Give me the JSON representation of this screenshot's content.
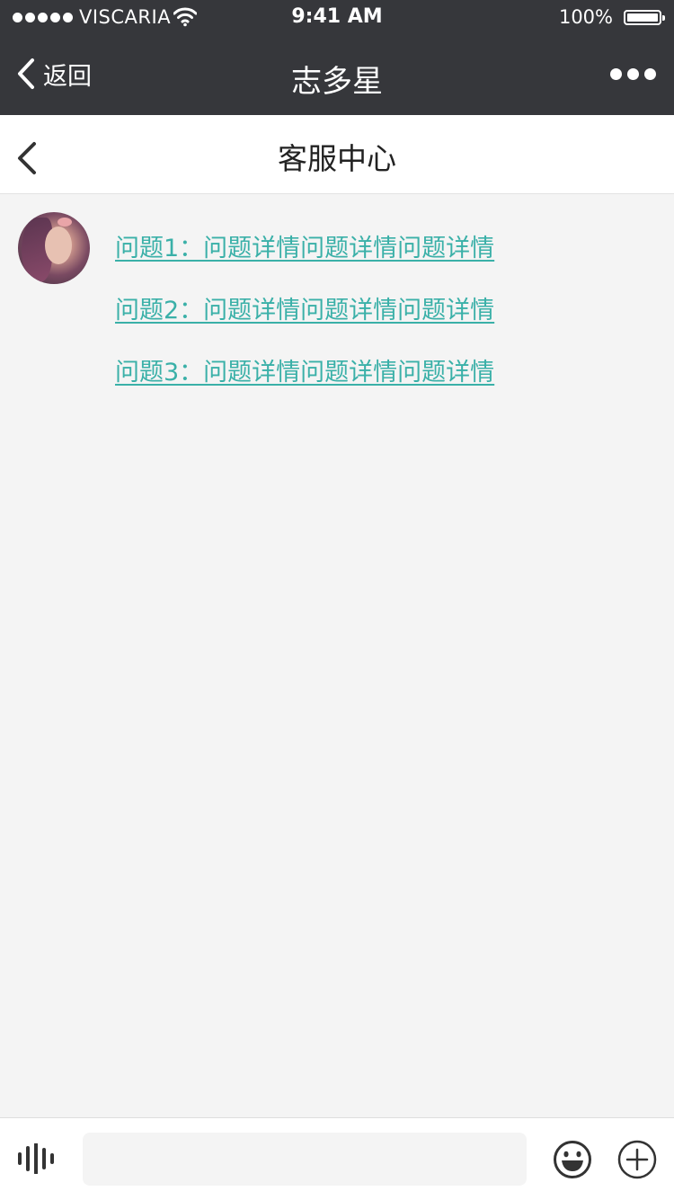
{
  "status_bar": {
    "carrier": "VISCARIA",
    "time": "9:41 AM",
    "battery": "100%"
  },
  "app_nav": {
    "back_label": "返回",
    "title": "志多星"
  },
  "page_header": {
    "title": "客服中心"
  },
  "chat": {
    "questions": [
      "问题1：问题详情问题详情问题详情",
      "问题2：问题详情问题详情问题详情",
      "问题3：问题详情问题详情问题详情"
    ]
  },
  "input_bar": {
    "placeholder": ""
  },
  "colors": {
    "nav_background": "#36373b",
    "link": "#3ab0a8",
    "page_background": "#f4f4f4"
  }
}
